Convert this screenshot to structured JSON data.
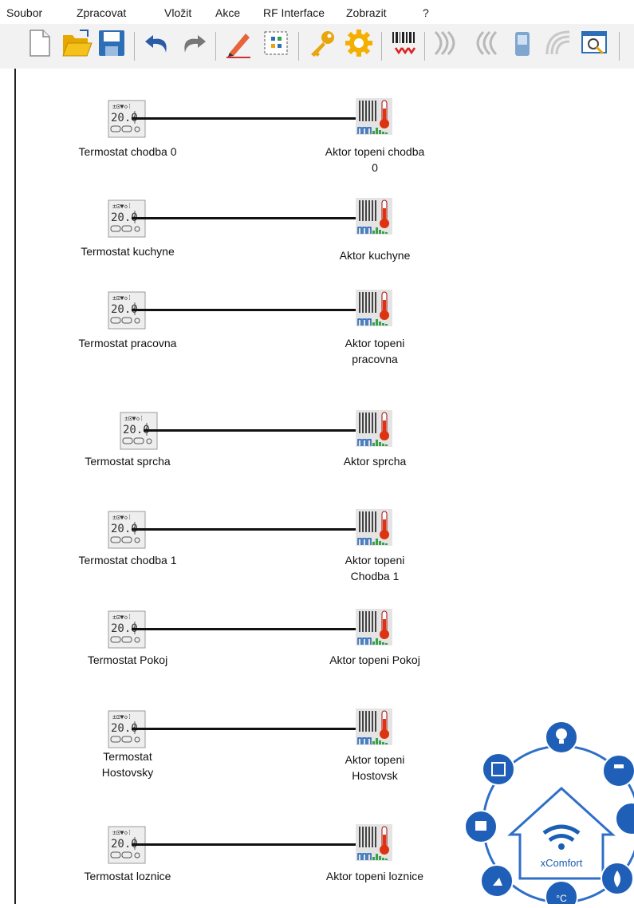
{
  "menu": [
    "Soubor",
    "Zpracovat",
    "Vložit",
    "Akce",
    "RF Interface",
    "Zobrazit",
    "?"
  ],
  "toolbar": {
    "icons": [
      "new-document-icon",
      "open-folder-icon",
      "save-floppy-icon",
      "undo-icon",
      "redo-icon",
      "pencil-icon",
      "edit-selection-icon",
      "key-icon",
      "gear-icon",
      "barcode-icon",
      "rf-signal-icon",
      "rf-signal-alt-icon",
      "phone-icon",
      "rf-signal-faded-icon",
      "search-window-icon"
    ],
    "colors": {
      "folder": "#f4c21a",
      "save": "#2d6fb7",
      "undo": "#2a5ba6",
      "pencil": "#e8643b",
      "key": "#e8a50e",
      "gear": "#f4b000"
    }
  },
  "pairs": [
    {
      "thermostat": [
        "Termostat chodba 0"
      ],
      "actuator": [
        "Aktor topeni chodba",
        "0"
      ]
    },
    {
      "thermostat": [
        "Termostat kuchyne"
      ],
      "actuator": [
        "Aktor kuchyne"
      ]
    },
    {
      "thermostat": [
        "Termostat pracovna"
      ],
      "actuator": [
        "Aktor topeni",
        "pracovna"
      ]
    },
    {
      "thermostat": [
        "Termostat sprcha"
      ],
      "actuator": [
        "Aktor sprcha"
      ]
    },
    {
      "thermostat": [
        "Termostat chodba 1"
      ],
      "actuator": [
        "Aktor topeni",
        "Chodba 1"
      ]
    },
    {
      "thermostat": [
        "Termostat Pokoj"
      ],
      "actuator": [
        "Aktor topeni Pokoj"
      ]
    },
    {
      "thermostat": [
        "Termostat",
        "Hostovsky"
      ],
      "actuator": [
        "Aktor topeni",
        "Hostovsk"
      ]
    },
    {
      "thermostat": [
        "Termostat loznice"
      ],
      "actuator": [
        "Aktor topeni loznice"
      ]
    }
  ],
  "thermostat_display": "20.0",
  "logo": {
    "text": "xComfort",
    "accent": "#1a5fb4",
    "ring": "#2f6fc9"
  }
}
